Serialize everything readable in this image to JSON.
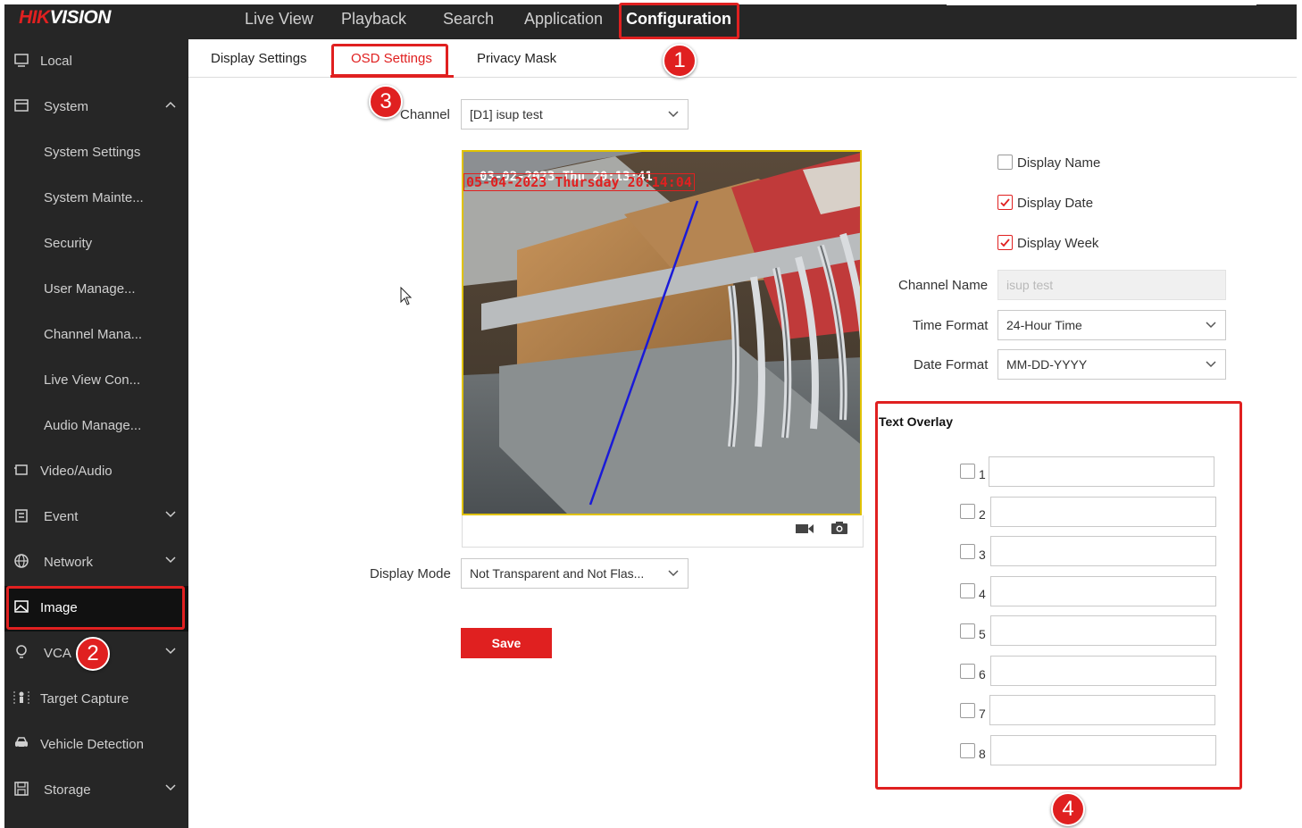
{
  "brand": {
    "logo_red": "HIK",
    "logo_white": "VISION"
  },
  "top_nav": [
    {
      "label": "Live View"
    },
    {
      "label": "Playback"
    },
    {
      "label": "Search"
    },
    {
      "label": "Application"
    },
    {
      "label": "Configuration"
    }
  ],
  "sidebar": {
    "items": [
      {
        "label": "Local",
        "icon": "monitor-icon"
      },
      {
        "label": "System",
        "icon": "system-icon",
        "expanded": true
      },
      {
        "label": "System Settings"
      },
      {
        "label": "System Mainte..."
      },
      {
        "label": "Security"
      },
      {
        "label": "User Manage..."
      },
      {
        "label": "Channel Mana..."
      },
      {
        "label": "Live View Con..."
      },
      {
        "label": "Audio Manage..."
      },
      {
        "label": "Video/Audio",
        "icon": "video-audio-icon"
      },
      {
        "label": "Event",
        "icon": "event-icon"
      },
      {
        "label": "Network",
        "icon": "network-icon"
      },
      {
        "label": "Image",
        "icon": "image-icon",
        "active": true
      },
      {
        "label": "VCA",
        "icon": "vca-icon"
      },
      {
        "label": "Target Capture",
        "icon": "target-capture-icon"
      },
      {
        "label": "Vehicle Detection",
        "icon": "vehicle-icon"
      },
      {
        "label": "Storage",
        "icon": "storage-icon"
      }
    ]
  },
  "tabs": [
    {
      "label": "Display Settings"
    },
    {
      "label": "OSD Settings",
      "active": true
    },
    {
      "label": "Privacy Mask"
    }
  ],
  "form": {
    "channel_label": "Channel",
    "channel_value": "[D1] isup test",
    "display_mode_label": "Display Mode",
    "display_mode_value": "Not Transparent and Not Flas...",
    "save_label": "Save"
  },
  "video": {
    "osd_white": "03-02-2023 Thu 20:13:41",
    "osd_red": "05-04-2023 Thursday 20:14:04"
  },
  "osd_options": {
    "display_name": {
      "label": "Display Name",
      "checked": false
    },
    "display_date": {
      "label": "Display Date",
      "checked": true
    },
    "display_week": {
      "label": "Display Week",
      "checked": true
    },
    "channel_name_label": "Channel Name",
    "channel_name_value": "isup test",
    "time_format_label": "Time Format",
    "time_format_value": "24-Hour Time",
    "date_format_label": "Date Format",
    "date_format_value": "MM-DD-YYYY"
  },
  "text_overlay": {
    "title": "Text Overlay",
    "rows": [
      {
        "num": "1",
        "value": ""
      },
      {
        "num": "2",
        "value": ""
      },
      {
        "num": "3",
        "value": ""
      },
      {
        "num": "4",
        "value": ""
      },
      {
        "num": "5",
        "value": ""
      },
      {
        "num": "6",
        "value": ""
      },
      {
        "num": "7",
        "value": ""
      },
      {
        "num": "8",
        "value": ""
      }
    ]
  },
  "annotations": [
    {
      "num": "1"
    },
    {
      "num": "2"
    },
    {
      "num": "3"
    },
    {
      "num": "4"
    }
  ],
  "colors": {
    "accent": "#e02020",
    "nav_bg": "#262626",
    "highlight": "#e0c200"
  }
}
